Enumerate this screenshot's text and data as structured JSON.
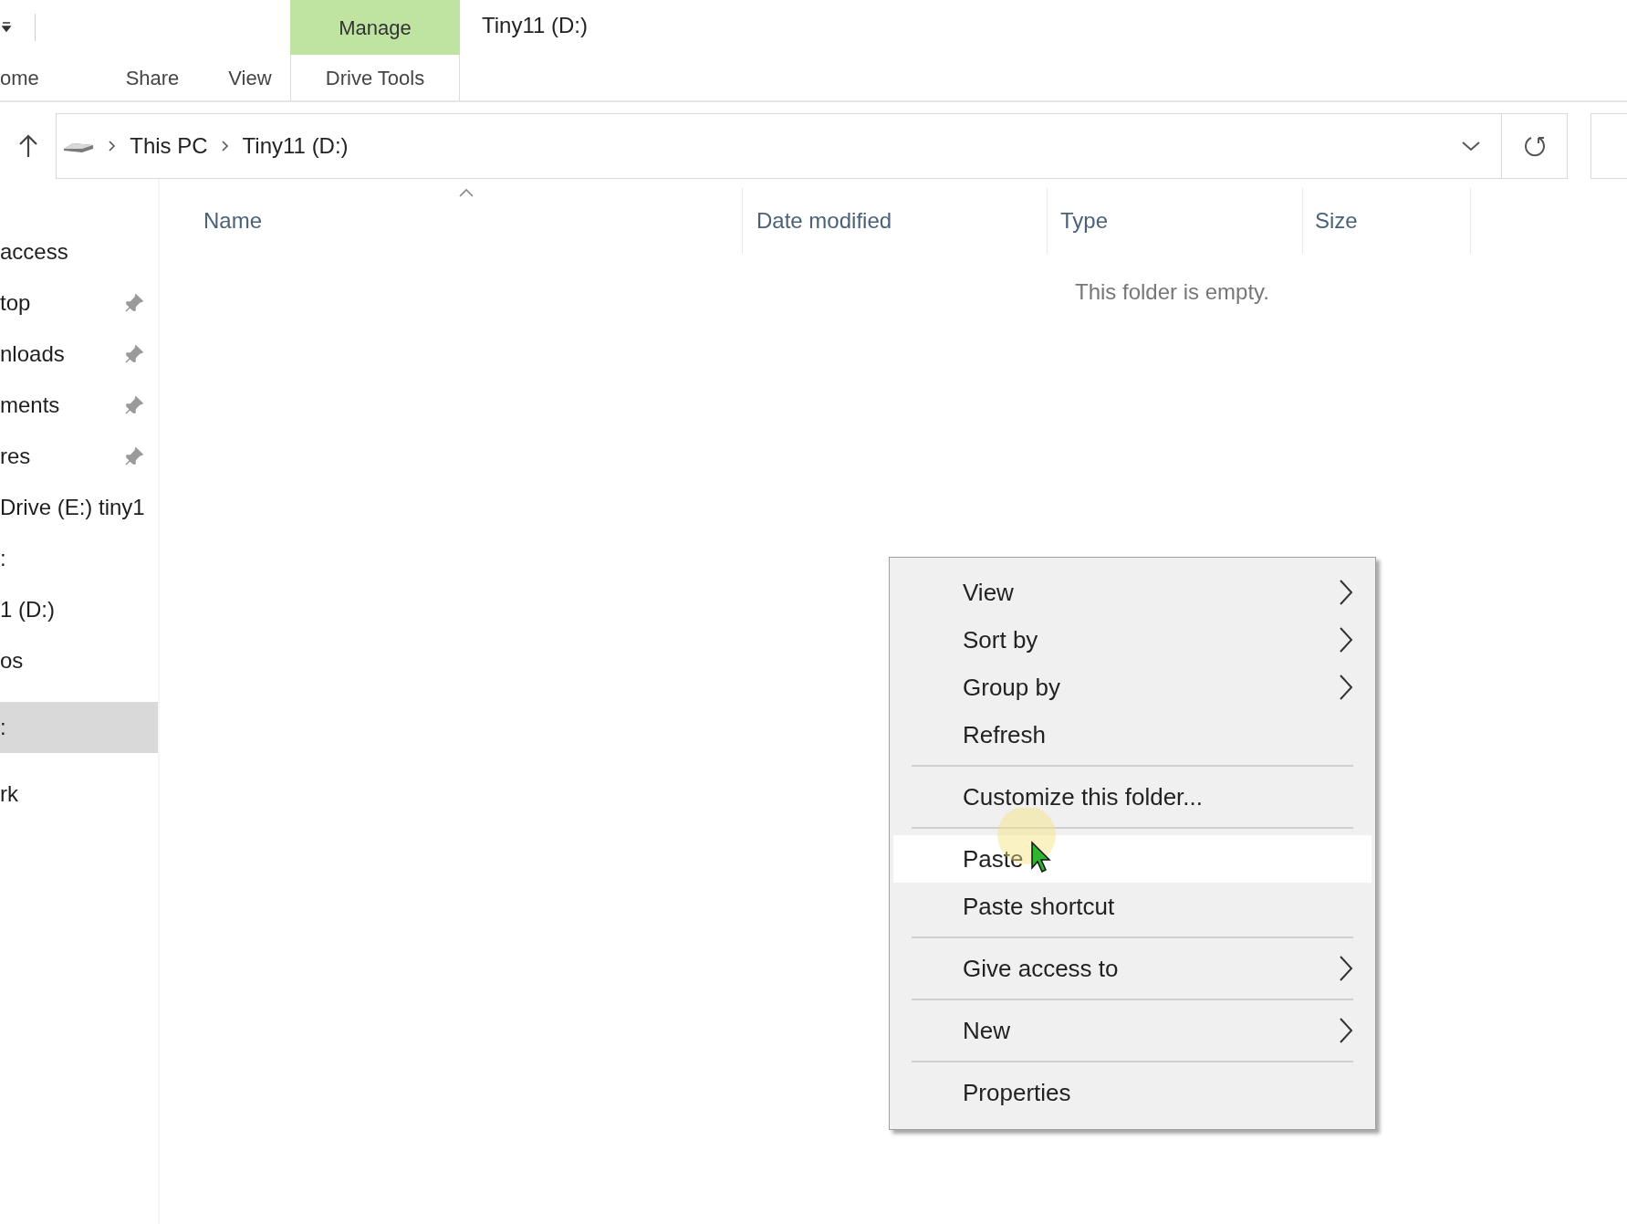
{
  "ribbon": {
    "contextual_group": {
      "label": "Manage"
    },
    "title": "Tiny11 (D:)",
    "tabs": [
      {
        "label": "ome",
        "contextual": false
      },
      {
        "label": "Share",
        "contextual": false
      },
      {
        "label": "View",
        "contextual": false
      },
      {
        "label": "Drive Tools",
        "contextual": true
      }
    ]
  },
  "address_bar": {
    "path": [
      "This PC",
      "Tiny11 (D:)"
    ]
  },
  "sidebar": {
    "groups": [
      [
        {
          "label": "access",
          "pinned": false,
          "selected": false
        },
        {
          "label": "top",
          "pinned": true,
          "selected": false
        },
        {
          "label": "nloads",
          "pinned": true,
          "selected": false
        },
        {
          "label": "ments",
          "pinned": true,
          "selected": false
        },
        {
          "label": "res",
          "pinned": true,
          "selected": false
        },
        {
          "label": "Drive (E:) tiny1",
          "pinned": false,
          "selected": false
        },
        {
          "label": ":",
          "pinned": false,
          "selected": false
        },
        {
          "label": "1 (D:)",
          "pinned": false,
          "selected": false
        },
        {
          "label": "os",
          "pinned": false,
          "selected": false
        }
      ],
      [
        {
          "label": ":",
          "pinned": false,
          "selected": true
        }
      ],
      [
        {
          "label": "rk",
          "pinned": false,
          "selected": false
        }
      ]
    ]
  },
  "columns": [
    {
      "label": "Name",
      "sorted": true
    },
    {
      "label": "Date modified",
      "sorted": false
    },
    {
      "label": "Type",
      "sorted": false
    },
    {
      "label": "Size",
      "sorted": false
    }
  ],
  "empty_message": "This folder is empty.",
  "context_menu": {
    "items": [
      {
        "kind": "item",
        "label": "View",
        "submenu": true,
        "selected": false
      },
      {
        "kind": "item",
        "label": "Sort by",
        "submenu": true,
        "selected": false
      },
      {
        "kind": "item",
        "label": "Group by",
        "submenu": true,
        "selected": false
      },
      {
        "kind": "item",
        "label": "Refresh",
        "submenu": false,
        "selected": false
      },
      {
        "kind": "separator"
      },
      {
        "kind": "item",
        "label": "Customize this folder...",
        "submenu": false,
        "selected": false
      },
      {
        "kind": "separator"
      },
      {
        "kind": "item",
        "label": "Paste",
        "submenu": false,
        "selected": true
      },
      {
        "kind": "item",
        "label": "Paste shortcut",
        "submenu": false,
        "selected": false
      },
      {
        "kind": "separator"
      },
      {
        "kind": "item",
        "label": "Give access to",
        "submenu": true,
        "selected": false
      },
      {
        "kind": "separator"
      },
      {
        "kind": "item",
        "label": "New",
        "submenu": true,
        "selected": false
      },
      {
        "kind": "separator"
      },
      {
        "kind": "item",
        "label": "Properties",
        "submenu": false,
        "selected": false
      }
    ]
  }
}
